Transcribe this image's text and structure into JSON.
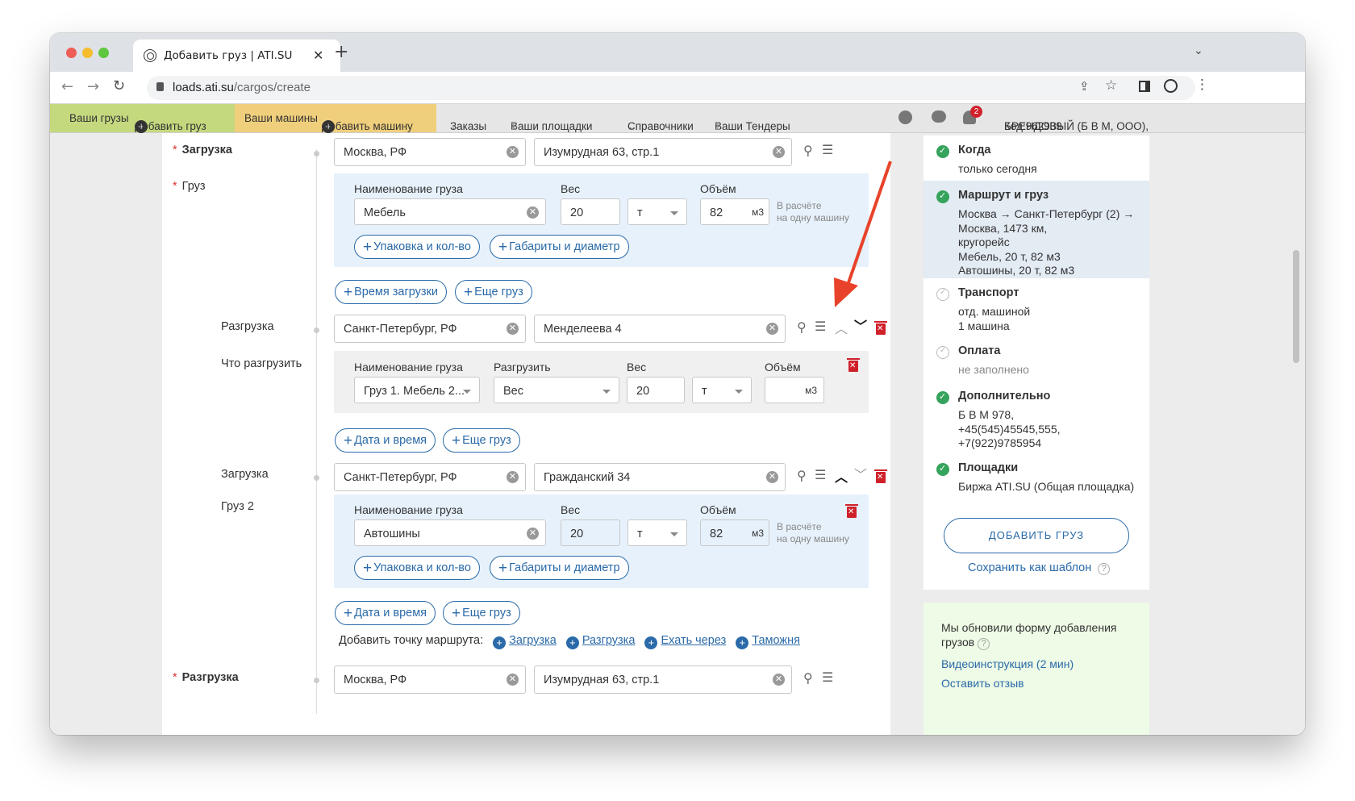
{
  "browser": {
    "tab_title": "Добавить груз | ATI.SU",
    "url_host": "loads.ati.su",
    "url_path": "/cargos/create"
  },
  "nav": {
    "my_cargo": "Ваши грузы",
    "add_cargo": "Добавить груз",
    "my_trucks": "Ваши машины",
    "add_truck": "Добавить машину",
    "orders": "Заказы",
    "platforms": "Ваши площадки",
    "platforms_count": "1",
    "refs": "Справочники",
    "tenders": "Ваши Тендеры",
    "tenders_count": "1",
    "badge": "2",
    "company": "БРЕНДОВЫЙ (Б В М, ООО),",
    "code": "Код:962939"
  },
  "route": {
    "load1": {
      "label": "Загрузка",
      "city": "Москва, РФ",
      "address": "Изумрудная 63, стр.1"
    },
    "cargo1": {
      "label": "Груз",
      "h_name": "Наименование груза",
      "h_weight": "Вес",
      "h_volume": "Объём",
      "name": "Мебель",
      "weight": "20",
      "unit": "т",
      "volume": "82",
      "vunit": "м3",
      "note1": "В расчёте",
      "note2": "на одну машину",
      "btn_pack": "Упаковка и кол-во",
      "btn_dims": "Габариты и диаметр"
    },
    "btn_time": "Время загрузки",
    "btn_more": "Еще груз",
    "unload1": {
      "label": "Разгрузка",
      "city": "Санкт-Петербург, РФ",
      "address": "Менделеева 4"
    },
    "what": {
      "label": "Что разгрузить",
      "h_name": "Наименование груза",
      "h_unload": "Разгрузить",
      "h_weight": "Вес",
      "h_volume": "Объём",
      "name": "Груз 1. Мебель  2...",
      "unload": "Вес",
      "weight": "20",
      "unit": "т",
      "vunit": "м3"
    },
    "btn_date": "Дата и время",
    "btn_more2": "Еще груз",
    "load2": {
      "label": "Загрузка",
      "city": "Санкт-Петербург, РФ",
      "address": "Гражданский 34"
    },
    "cargo2": {
      "label": "Груз 2",
      "h_name": "Наименование груза",
      "h_weight": "Вес",
      "h_volume": "Объём",
      "name": "Автошины",
      "weight": "20",
      "unit": "т",
      "volume": "82",
      "vunit": "м3",
      "note1": "В расчёте",
      "note2": "на одну машину",
      "btn_pack": "Упаковка и кол-во",
      "btn_dims": "Габариты и диаметр"
    },
    "btn_date2": "Дата и время",
    "btn_more3": "Еще груз",
    "add_point": "Добавить точку маршрута:",
    "pt_load": "Загрузка",
    "pt_unload": "Разгрузка",
    "pt_via": "Ехать через",
    "pt_customs": "Таможня",
    "unload2": {
      "label": "Разгрузка",
      "city": "Москва, РФ",
      "address": "Изумрудная 63, стр.1"
    }
  },
  "summary": {
    "when_t": "Когда",
    "when_v": "только сегодня",
    "route_t": "Маршрут и груз",
    "route_v": "Москва → Санкт-Петербург (2) →\nМосква, 1473 км,\nкругорейс\nМебель, 20 т, 82 м3\nАвтошины, 20 т, 82 м3",
    "transport_t": "Транспорт",
    "transport_v": "отд. машиной\n1 машина",
    "pay_t": "Оплата",
    "pay_v": "не заполнено",
    "extra_t": "Дополнительно",
    "extra_v": "Б В М 978,\n+45(545)45545,555,\n+7(922)9785954",
    "platforms_t": "Площадки",
    "platforms_v": "Биржа ATI.SU (Общая площадка)",
    "add_btn": "ДОБАВИТЬ ГРУЗ",
    "save_tpl": "Сохранить как шаблон"
  },
  "info": {
    "text": "Мы обновили форму добавления грузов",
    "video": "Видеоинструкция (2 мин)",
    "feedback": "Оставить отзыв"
  },
  "colors": {
    "nav_green": "#c4d97e",
    "nav_yellow": "#f0cf7c",
    "link": "#2a6aa8",
    "arrow": "#e8432a",
    "trash": "#d0212b"
  }
}
